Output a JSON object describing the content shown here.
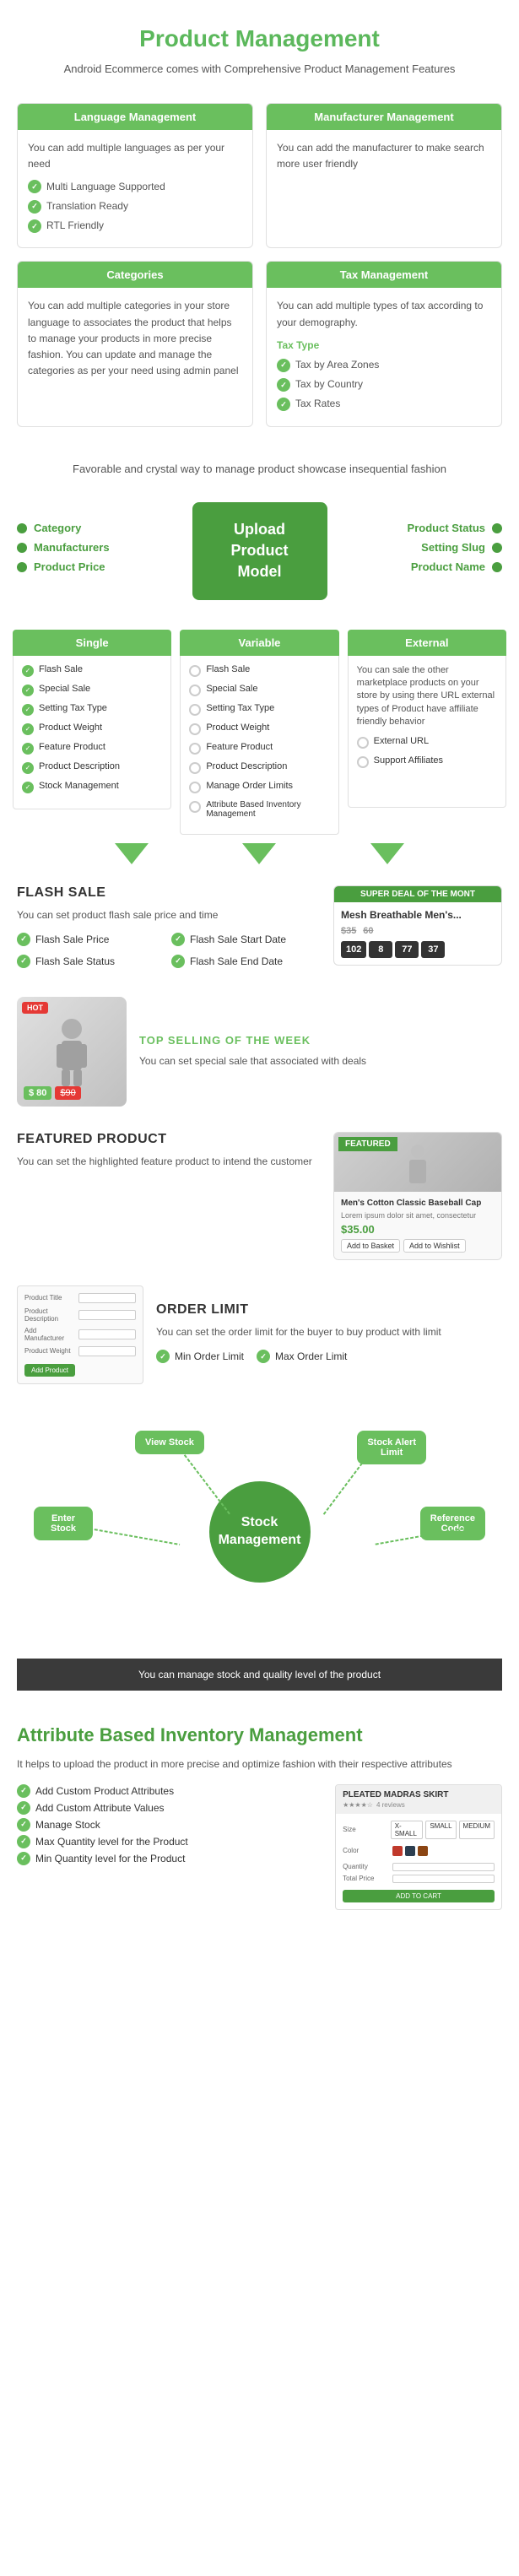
{
  "page": {
    "title": "Product Management",
    "subtitle": "Android Ecommerce comes with Comprehensive Product Management Features"
  },
  "language_box": {
    "header": "Language Management",
    "desc": "You can add multiple languages as per your need",
    "items": [
      "Multi Language Supported",
      "Translation Ready",
      "RTL Friendly"
    ]
  },
  "manufacturer_box": {
    "header": "Manufacturer Management",
    "desc": "You can add the manufacturer to make search more user friendly"
  },
  "categories_box": {
    "header": "Categories",
    "desc": "You can add multiple categories in your store language to associates the product that helps to manage your products in more precise fashion. You can update and manage the categories as per your need using admin panel"
  },
  "tax_box": {
    "header": "Tax Management",
    "desc": "You can add multiple types of tax according to your demography.",
    "type_label": "Tax Type",
    "items": [
      "Tax by Area Zones",
      "Tax by Country",
      "Tax Rates"
    ]
  },
  "upload_section": {
    "subtitle": "Favorable and crystal way to manage product showcase insequential fashion",
    "center_label": "Upload\nProduct\nModel",
    "left_items": [
      "Category",
      "Manufacturers",
      "Product Price"
    ],
    "right_items": [
      "Product Status",
      "Setting Slug",
      "Product Name"
    ]
  },
  "product_types": {
    "single": {
      "label": "Single",
      "items": [
        "Flash Sale",
        "Special Sale",
        "Setting Tax Type",
        "Product Weight",
        "Feature Product",
        "Product Description",
        "Stock Management"
      ]
    },
    "variable": {
      "label": "Variable",
      "items": [
        "Flash Sale",
        "Special Sale",
        "Setting Tax Type",
        "Product Weight",
        "Feature Product",
        "Product Description",
        "Manage Order Limits",
        "Attribute Based Inventory Management"
      ]
    },
    "external": {
      "label": "External",
      "desc": "You can sale the other marketplace products on your store by using there URL external types of Product have affiliate friendly behavior",
      "items": [
        "External URL",
        "Support Affiliates"
      ]
    }
  },
  "flash_sale": {
    "title": "FLASH SALE",
    "desc": "You can set product flash sale price and time",
    "checks": [
      "Flash Sale Price",
      "Flash Sale Status",
      "Flash Sale Start Date",
      "Flash Sale End Date"
    ],
    "deal_card": {
      "header": "SUPER DEAL OF THE MONT",
      "product_name": "Mesh Breathable Men's...",
      "price_new": "$35",
      "price_old": "60",
      "timer": [
        "102",
        "8",
        "77",
        "37"
      ]
    }
  },
  "top_selling": {
    "label": "TOP SELLING OF THE WEEK",
    "desc": "You can set special sale that associated with deals",
    "badge": "HOT",
    "price_new": "$ 80",
    "price_old": "$90"
  },
  "featured_product": {
    "title": "FEATURED PRODUCT",
    "desc": "You can set the highlighted feature product to intend the customer",
    "card": {
      "badge": "FEATURED",
      "product_name": "Men's Cotton Classic Baseball Cap",
      "product_desc": "Lorem ipsum dolor sit amet, consectetur",
      "price": "$35.00",
      "btn1": "Add to Basket",
      "btn2": "Add to Wishlist"
    }
  },
  "order_limit": {
    "title": "ORDER LIMIT",
    "desc": "You can set the order limit for the buyer to buy product with limit",
    "checks": [
      "Min Order Limit",
      "Max Order Limit"
    ],
    "form": {
      "fields": [
        "Product Title",
        "Product Description",
        "Add Manufacturer",
        "Product Weight"
      ],
      "btn": "Add Product"
    }
  },
  "stock_management": {
    "center_label": "Stock\nManagement",
    "nodes": [
      {
        "id": "view-stock",
        "label": "View\nStock"
      },
      {
        "id": "stock-alert",
        "label": "Stock Alert\nLimit"
      },
      {
        "id": "enter-stock",
        "label": "Enter\nStock"
      },
      {
        "id": "reference-code",
        "label": "Reference\nCode"
      }
    ],
    "bottom_text": "You can manage stock and quality level of the product"
  },
  "attribute_inventory": {
    "title": "Attribute Based Inventory Management",
    "desc": "It helps to upload the product in more precise and optimize fashion with their respective attributes",
    "items": [
      "Add Custom Product Attributes",
      "Add Custom Attribute Values",
      "Manage Stock",
      "Max Quantity level for the Product",
      "Min Quantity level for the Product"
    ],
    "card": {
      "title": "PLEATED MADRAS SKIRT",
      "size_label": "Size",
      "sizes": [
        "X-SMALL",
        "SMALL",
        "MEDIUM"
      ],
      "color_label": "Color",
      "colors": [
        "#c0392b",
        "#2c3e50",
        "#8B4513"
      ],
      "quantity_label": "Quantity",
      "total_label": "Total Price",
      "btn": "ADD TO CART"
    }
  }
}
